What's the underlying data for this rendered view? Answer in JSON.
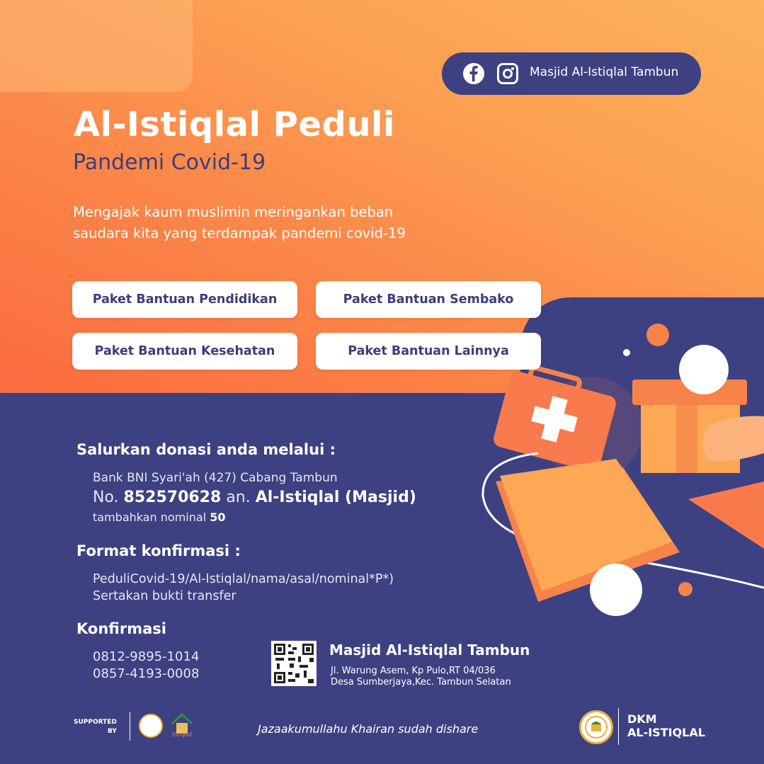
{
  "social": {
    "label": "Masjid Al-Istiqlal Tambun",
    "icons": [
      "facebook-icon",
      "instagram-icon"
    ]
  },
  "header": {
    "title": "Al-Istiqlal Peduli",
    "subtitle": "Pandemi Covid-19"
  },
  "intro": {
    "line1": "Mengajak kaum muslimin meringankan beban",
    "line2": "saudara kita yang terdampak pandemi covid-19"
  },
  "packages": [
    "Paket Bantuan Pendidikan",
    "Paket Bantuan Sembako",
    "Paket Bantuan Kesehatan",
    "Paket Bantuan Lainnya"
  ],
  "donation": {
    "heading": "Salurkan donasi anda melalui :",
    "bank": "Bank BNI Syari'ah (427) Cabang Tambun",
    "no_prefix": "No.",
    "account_no": "852570628",
    "an_prefix": "an.",
    "account_name": "Al-Istiqlal (Masjid)",
    "nominal_prefix": "tambahkan nominal",
    "nominal_value": "50"
  },
  "format": {
    "heading": "Format konfirmasi :",
    "line1": "PeduliCovid-19/Al-Istiqlal/nama/asal/nominal*P*)",
    "line2": "Sertakan bukti transfer"
  },
  "confirm": {
    "heading": "Konfirmasi",
    "phone1": "0812-9895-1014",
    "phone2": "0857-4193-0008"
  },
  "mosque": {
    "name": "Masjid Al-Istiqlal Tambun",
    "addr1": "Jl. Warung Asem, Kp Pulo,RT 04/036",
    "addr2": "Desa Sumberjaya,Kec. Tambun Selatan"
  },
  "footer": {
    "supported_line1": "SUPPORTED",
    "supported_line2": "BY",
    "thanks": "Jazaakumullahu Khairan sudah dishare",
    "dkm_line1": "DKM",
    "dkm_line2": "AL-ISTIQLAL"
  },
  "colors": {
    "orange": "#fb6b3f",
    "navy": "#3d4181",
    "accent": "#f6834a"
  }
}
